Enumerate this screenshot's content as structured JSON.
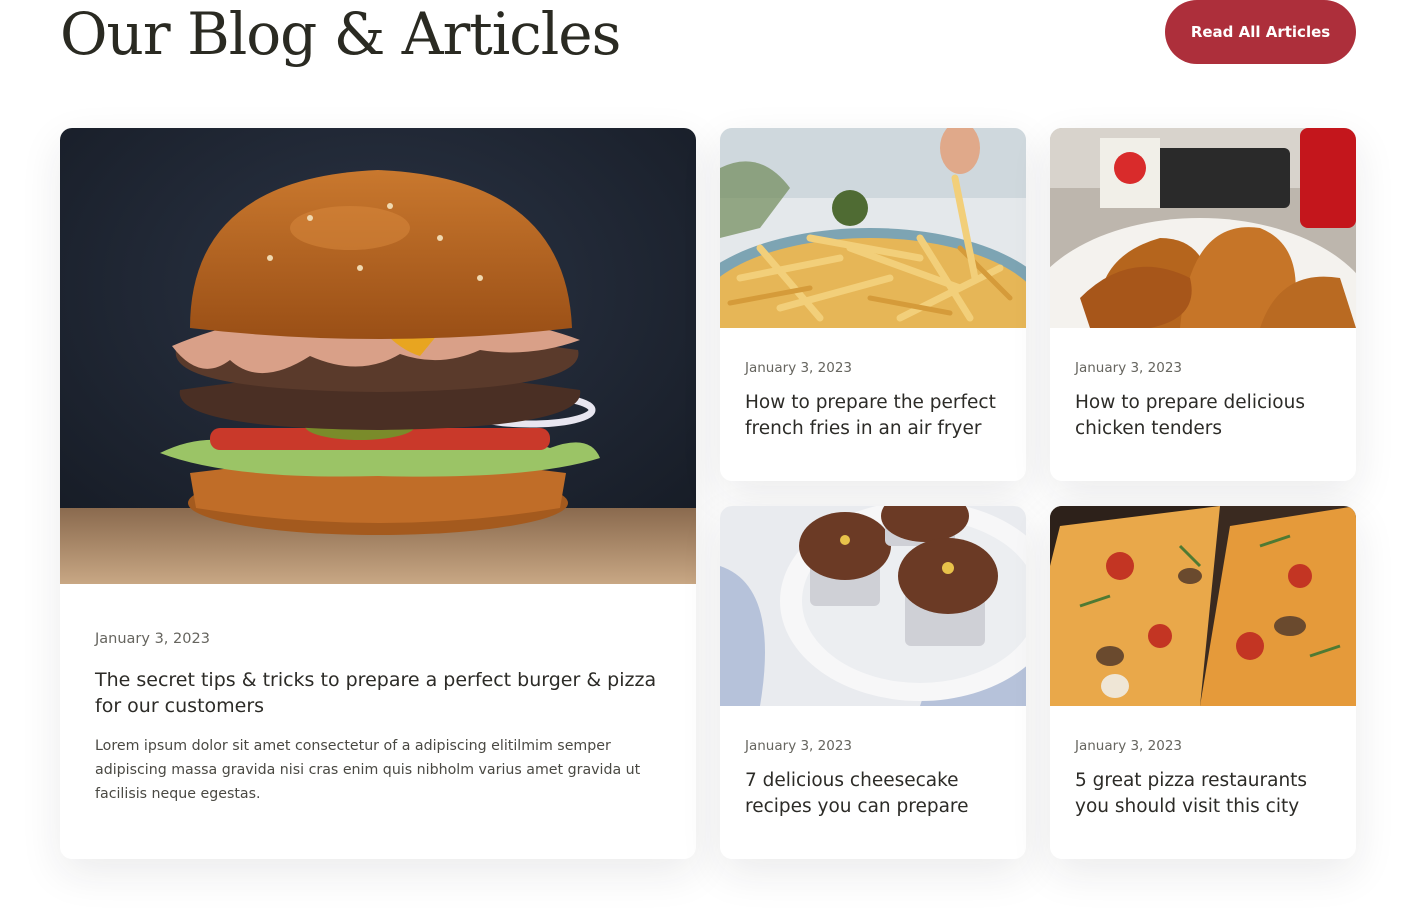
{
  "header": {
    "title": "Our Blog & Articles",
    "cta_label": "Read All Articles",
    "accent_color": "#ad2f3b"
  },
  "featured": {
    "image": "burger-photo",
    "date": "January 3, 2023",
    "title": "The secret tips & tricks to prepare a perfect burger & pizza for our customers",
    "excerpt": "Lorem ipsum dolor sit amet consectetur of a adipiscing elitilmim semper adipiscing massa gravida nisi cras enim quis nibholm varius amet gravida ut facilisis neque egestas."
  },
  "articles": [
    {
      "image": "french-fries-photo",
      "date": "January 3, 2023",
      "title": "How to prepare the perfect french fries in an air fryer"
    },
    {
      "image": "chicken-tenders-photo",
      "date": "January 3, 2023",
      "title": "How to prepare delicious chicken tenders"
    },
    {
      "image": "cupcakes-photo",
      "date": "January 3, 2023",
      "title": "7 delicious cheesecake recipes you can prepare"
    },
    {
      "image": "pizza-photo",
      "date": "January 3, 2023",
      "title": "5 great pizza restaurants you should visit this city"
    }
  ]
}
